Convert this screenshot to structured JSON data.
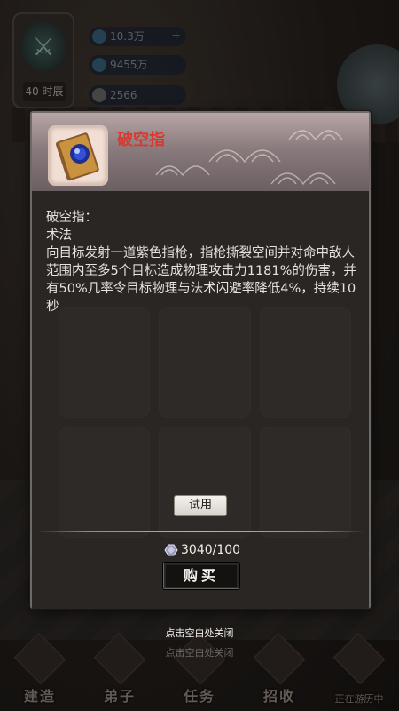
{
  "hud": {
    "level": "40",
    "level_suffix": "时辰",
    "resource_1": "10.3万",
    "resource_2": "9455万",
    "resource_3": "2566",
    "plus_sign": "+"
  },
  "item": {
    "title": "破空指",
    "name_line": "破空指：",
    "type_line": "术法",
    "description": "向目标发射一道紫色指枪，指枪撕裂空间并对命中敌人范围内至多5个目标造成物理攻击力1181%的伤害，并有50%几率令目标物理与法术闪避率降低4%，持续10秒",
    "icon": "skill-book-icon"
  },
  "actions": {
    "try_label": "试用",
    "price": "3040/100",
    "currency_icon": "jade-currency-icon",
    "buy_label": "购买"
  },
  "hints": {
    "close_hint": "点击空白处关闭",
    "close_hint_ghost": "点击空白处关闭"
  },
  "bottom_nav": [
    {
      "label": "建造"
    },
    {
      "label": "弟子"
    },
    {
      "label": "任务"
    },
    {
      "label": "招收"
    },
    {
      "label": "正在游历中"
    }
  ],
  "colors": {
    "title_red": "#d63a30",
    "panel_bg": "#262221",
    "header_pink": "#b8a6a6"
  }
}
